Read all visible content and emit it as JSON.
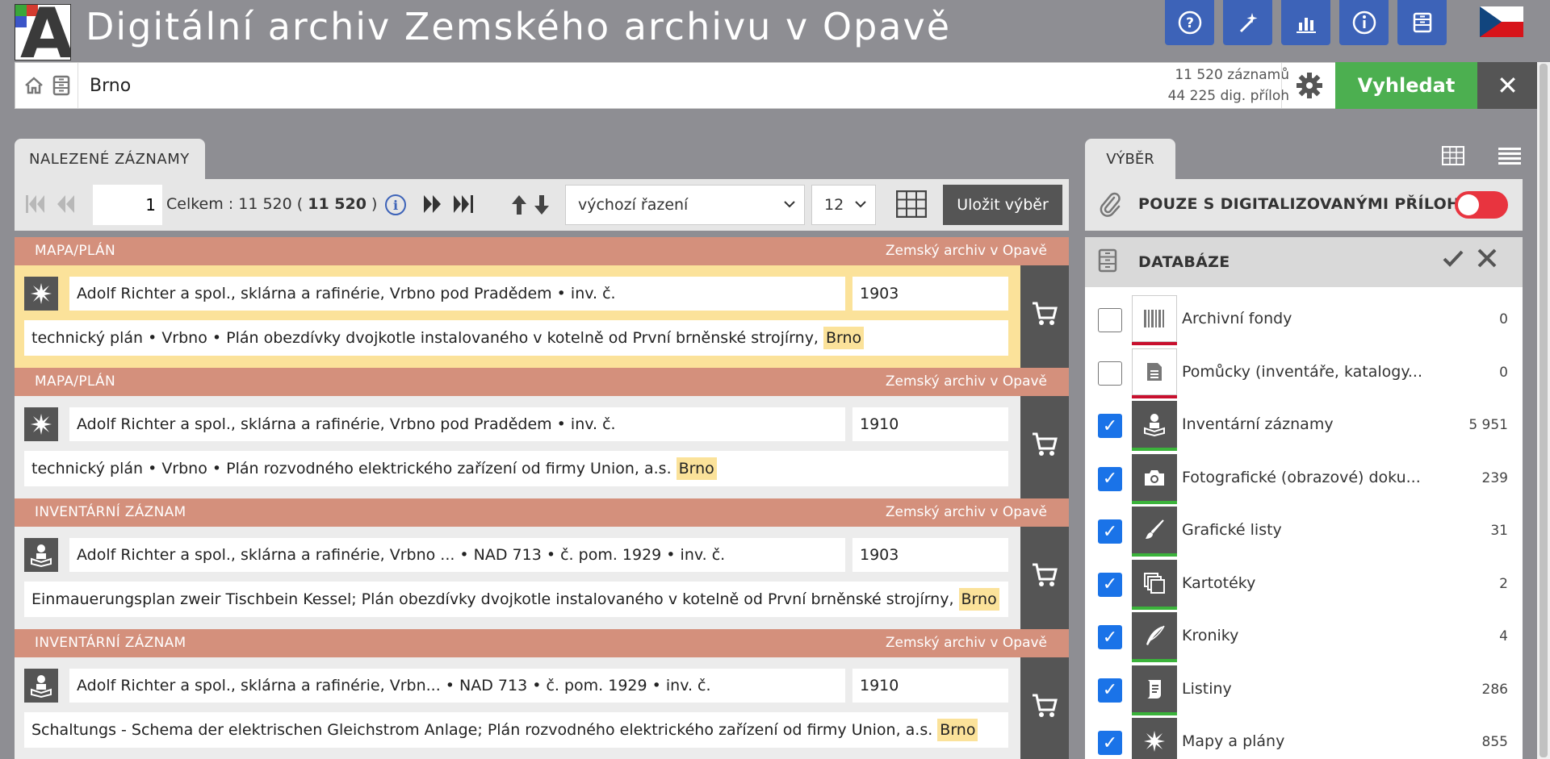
{
  "header": {
    "title": "Digitální archiv  Zemského archivu v Opavě",
    "logo_letter": "A",
    "buttons": [
      {
        "name": "help-icon",
        "glyph": "?"
      },
      {
        "name": "magic-wand-icon",
        "glyph": "✦"
      },
      {
        "name": "chart-icon",
        "glyph": "▥"
      },
      {
        "name": "info-icon",
        "glyph": "i"
      },
      {
        "name": "archive-box-icon",
        "glyph": "▤"
      }
    ],
    "language_flag": "cz-flag-icon"
  },
  "search": {
    "value": "Brno",
    "records_count": "11 520 záznamů",
    "attachments_count": "44 225 dig. příloh",
    "search_label": "Vyhledat",
    "clear_glyph": "✕"
  },
  "results_panel": {
    "tab_label": "NALEZENÉ ZÁZNAMY",
    "page": "1",
    "total_prefix": "Celkem : 11 520 (",
    "total_bold": "11 520",
    "total_suffix": ")",
    "sort_value": "výchozí řazení",
    "per_page": "12",
    "save_label": "Uložit výběr"
  },
  "results": [
    {
      "type": "MAPA/PLÁN",
      "archive": "Zemský archiv v Opavě",
      "icon": "map-star-icon",
      "title": "Adolf Richter a spol., sklárna a rafinérie, Vrbno pod Pradědem • inv. č.",
      "year": "1903",
      "desc": "technický plán • Vrbno • Plán obezdívky dvojkotle instalovaného v kotelně od První brněnské strojírny,",
      "highlight": "Brno",
      "selected": true
    },
    {
      "type": "MAPA/PLÁN",
      "archive": "Zemský archiv v Opavě",
      "icon": "map-star-icon",
      "title": "Adolf Richter a spol., sklárna a rafinérie, Vrbno pod Pradědem • inv. č.",
      "year": "1910",
      "desc": "technický plán • Vrbno • Plán rozvodného elektrického zařízení od firmy Union, a.s.",
      "highlight": "Brno",
      "selected": false
    },
    {
      "type": "INVENTÁRNÍ ZÁZNAM",
      "archive": "Zemský archiv v Opavě",
      "icon": "reader-icon",
      "title": "Adolf Richter a spol., sklárna a rafinérie, Vrbno ... • NAD 713 • č. pom. 1929 • inv. č.",
      "year": "1903",
      "desc": "Einmauerungsplan zweir Tischbein Kessel; Plán obezdívky dvojkotle instalovaného v kotelně od První brněnské strojírny,",
      "highlight": "Brno",
      "selected": false
    },
    {
      "type": "INVENTÁRNÍ ZÁZNAM",
      "archive": "Zemský archiv v Opavě",
      "icon": "reader-icon",
      "title": "Adolf Richter a spol., sklárna a rafinérie, Vrbn... • NAD 713 • č. pom. 1929 • inv. č.",
      "year": "1910",
      "desc": "Schaltungs - Schema der elektrischen Gleichstrom Anlage; Plán rozvodného elektrického zařízení od firmy Union, a.s.",
      "highlight": "Brno",
      "selected": false
    }
  ],
  "selection_panel": {
    "tab_label": "VÝBĚR",
    "only_digitized_label": "POUZE S DIGITALIZOVANÝMI PŘÍLOH...",
    "only_digitized_on": false,
    "database_label": "DATABÁZE"
  },
  "databases": [
    {
      "label": "Archivní fondy",
      "count": "0",
      "checked": false,
      "icon": "barcode-icon",
      "bar": "#c8102e"
    },
    {
      "label": "Pomůcky (inventáře, katalogy...",
      "count": "0",
      "checked": false,
      "icon": "document-icon",
      "bar": "#c8102e"
    },
    {
      "label": "Inventární záznamy",
      "count": "5 951",
      "checked": true,
      "icon": "reader-icon",
      "bar": "#3bb33b"
    },
    {
      "label": "Fotografické (obrazové) doku...",
      "count": "239",
      "checked": true,
      "icon": "camera-icon",
      "bar": "#3bb33b"
    },
    {
      "label": "Grafické listy",
      "count": "31",
      "checked": true,
      "icon": "brush-icon",
      "bar": "#3bb33b"
    },
    {
      "label": "Kartotéky",
      "count": "2",
      "checked": true,
      "icon": "cards-icon",
      "bar": "#3bb33b"
    },
    {
      "label": "Kroniky",
      "count": "4",
      "checked": true,
      "icon": "quill-icon",
      "bar": "#3bb33b"
    },
    {
      "label": "Listiny",
      "count": "286",
      "checked": true,
      "icon": "scroll-icon",
      "bar": "#3bb33b"
    },
    {
      "label": "Mapy a plány",
      "count": "855",
      "checked": true,
      "icon": "map-star-icon",
      "bar": "#3bb33b"
    }
  ]
}
